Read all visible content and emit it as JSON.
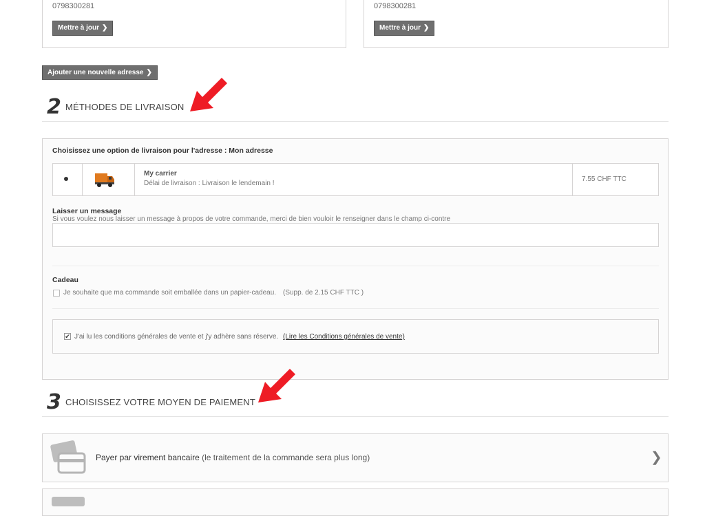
{
  "addresses": [
    {
      "phone": "0798300281",
      "update_label": "Mettre à jour"
    },
    {
      "phone": "0798300281",
      "update_label": "Mettre à jour"
    }
  ],
  "add_address_label": "Ajouter une nouvelle adresse",
  "step2": {
    "number": "2",
    "title": "MÉTHODES DE LIVRAISON"
  },
  "delivery": {
    "heading": "Choisissez une option de livraison pour l'adresse : Mon adresse",
    "carrier_name": "My carrier",
    "carrier_delay": "Délai de livraison : Livraison le lendemain !",
    "carrier_price": "7.55 CHF TTC"
  },
  "message": {
    "label": "Laisser un message",
    "hint": "Si vous voulez nous laisser un message à propos de votre commande, merci de bien vouloir le renseigner dans le champ ci-contre",
    "value": ""
  },
  "gift": {
    "label": "Cadeau",
    "option": "Je souhaite que ma commande soit emballée dans un papier-cadeau.",
    "supplement": "(Supp. de 2.15 CHF TTC )",
    "checked": false
  },
  "terms": {
    "text": "J'ai lu les conditions générales de vente et j'y adhère sans réserve.",
    "link": "(Lire les Conditions générales de vente)",
    "checked": true
  },
  "step3": {
    "number": "3",
    "title": "CHOISISSEZ VOTRE MOYEN DE PAIEMENT"
  },
  "payment": [
    {
      "label": "Payer par virement bancaire",
      "note": "(le traitement de la commande sera plus long)",
      "icon": "card-icon"
    }
  ],
  "colors": {
    "annotation_arrow": "#ee1c25",
    "button": "#6f6f6f",
    "panel_bg": "#fbfbfb",
    "border": "#d6d4d4"
  }
}
